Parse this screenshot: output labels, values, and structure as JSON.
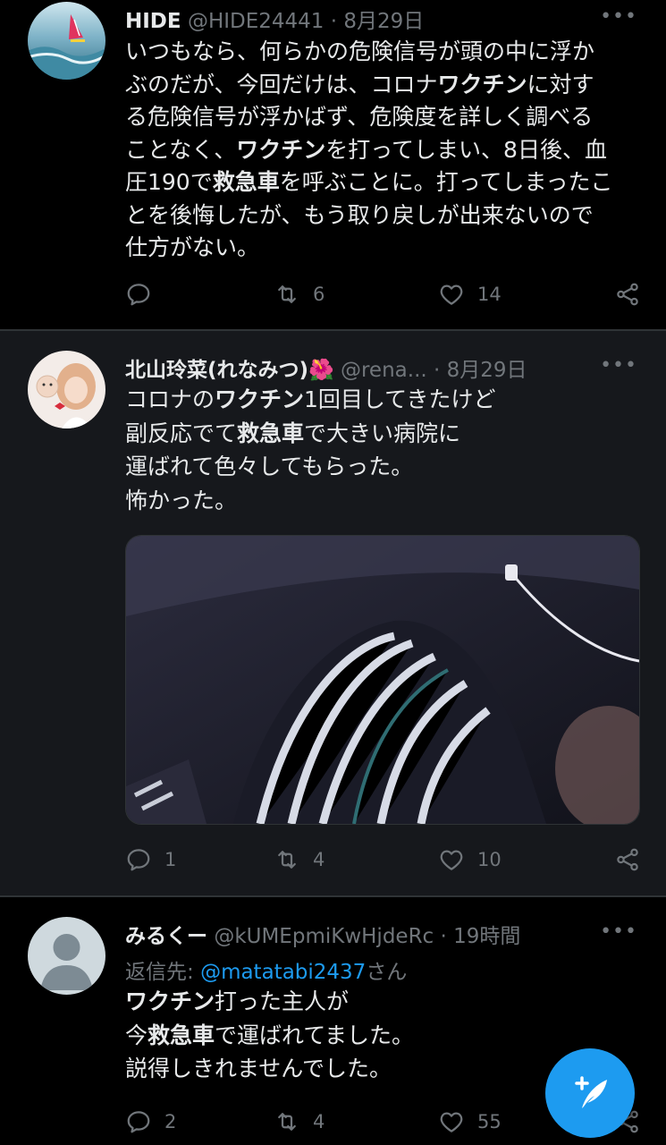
{
  "tweets": [
    {
      "name": "HIDE",
      "handle": "@HIDE24441",
      "time": "8月29日",
      "lines": [
        [
          {
            "t": "いつもなら、何らかの危険信号が頭の中に浮か",
            "b": false
          }
        ],
        [
          {
            "t": "ぶのだが、今回だけは、コロナ",
            "b": false
          },
          {
            "t": "ワクチン",
            "b": true
          },
          {
            "t": "に対す",
            "b": false
          }
        ],
        [
          {
            "t": "る危険信号が浮かばず、危険度を詳しく調べる",
            "b": false
          }
        ],
        [
          {
            "t": "ことなく、",
            "b": false
          },
          {
            "t": "ワクチン",
            "b": true
          },
          {
            "t": "を打ってしまい、8日後、血",
            "b": false
          }
        ],
        [
          {
            "t": "圧190で",
            "b": false
          },
          {
            "t": "救急車",
            "b": true
          },
          {
            "t": "を呼ぶことに。打ってしまったこ",
            "b": false
          }
        ],
        [
          {
            "t": "とを後悔したが、もう取り戻しが出来ないので",
            "b": false
          }
        ],
        [
          {
            "t": "仕方がない。",
            "b": false
          }
        ]
      ],
      "reply_count": "",
      "retweet_count": "6",
      "like_count": "14"
    },
    {
      "name": "北山玲菜(れなみつ)",
      "name_emoji": "🌺",
      "handle": "@rena...",
      "time": "8月29日",
      "lines": [
        [
          {
            "t": "コロナの",
            "b": false
          },
          {
            "t": "ワクチン",
            "b": true
          },
          {
            "t": "1回目してきたけど",
            "b": false
          }
        ],
        [
          {
            "t": "副反応でて",
            "b": false
          },
          {
            "t": "救急車",
            "b": true
          },
          {
            "t": "で大きい病院に",
            "b": false
          }
        ],
        [
          {
            "t": "運ばれて色々してもらった。",
            "b": false
          }
        ],
        [
          {
            "t": "怖かった。",
            "b": false
          }
        ]
      ],
      "reply_count": "1",
      "retweet_count": "4",
      "like_count": "10"
    },
    {
      "name": "みるくー",
      "handle": "@kUMEpmiKwHjdeRc",
      "time": "19時間",
      "reply_to_prefix": "返信先: ",
      "reply_to_handle": "@matatabi2437",
      "reply_to_suffix": "さん",
      "lines": [
        [
          {
            "t": "ワクチン",
            "b": true
          },
          {
            "t": "打った主人が",
            "b": false
          }
        ],
        [
          {
            "t": "今",
            "b": false
          },
          {
            "t": "救急車",
            "b": true
          },
          {
            "t": "で運ばれてました。",
            "b": false
          }
        ],
        [
          {
            "t": "説得しきれませんでした。",
            "b": false
          }
        ]
      ],
      "reply_count": "2",
      "retweet_count": "4",
      "like_count": "55"
    }
  ],
  "icons": {
    "more": "more-dots-icon",
    "reply": "reply-bubble-icon",
    "retweet": "retweet-arrows-icon",
    "like": "heart-icon",
    "share": "share-nodes-icon",
    "compose": "compose-feather-icon"
  },
  "colors": {
    "background": "#000000",
    "highlight_row": "#16181c",
    "text": "#e7e9ea",
    "muted": "#71767b",
    "accent": "#1d9bf0"
  },
  "separator": "·",
  "more_glyph": "•••"
}
